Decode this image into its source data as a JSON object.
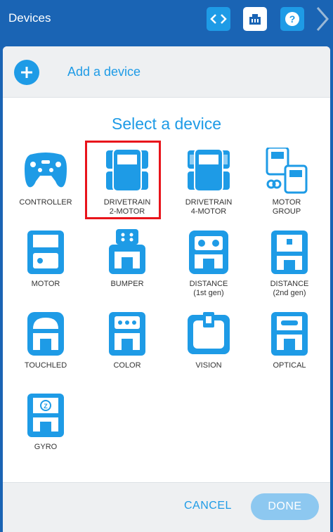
{
  "header": {
    "title": "Devices"
  },
  "add_device": {
    "label": "Add a device"
  },
  "select_title": "Select a device",
  "devices": [
    {
      "line1": "CONTROLLER",
      "line2": ""
    },
    {
      "line1": "DRIVETRAIN",
      "line2": "2-MOTOR",
      "selected": true
    },
    {
      "line1": "DRIVETRAIN",
      "line2": "4-MOTOR"
    },
    {
      "line1": "MOTOR",
      "line2": "GROUP"
    },
    {
      "line1": "MOTOR",
      "line2": ""
    },
    {
      "line1": "BUMPER",
      "line2": ""
    },
    {
      "line1": "DISTANCE",
      "line2": "(1st gen)"
    },
    {
      "line1": "DISTANCE",
      "line2": "(2nd gen)"
    },
    {
      "line1": "TOUCHLED",
      "line2": ""
    },
    {
      "line1": "COLOR",
      "line2": ""
    },
    {
      "line1": "VISION",
      "line2": ""
    },
    {
      "line1": "OPTICAL",
      "line2": ""
    },
    {
      "line1": "GYRO",
      "line2": ""
    }
  ],
  "footer": {
    "cancel": "CANCEL",
    "done": "DONE"
  },
  "colors": {
    "primary": "#1e9be6",
    "header": "#1a64b4",
    "selection": "#e8141b"
  }
}
